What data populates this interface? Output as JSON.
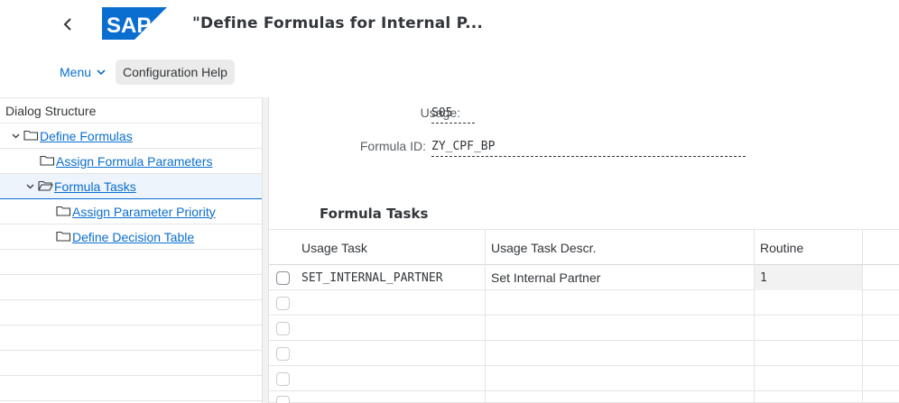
{
  "header": {
    "title": "\"Define Formulas for Internal P...",
    "logo_text": "SAP"
  },
  "toolbar": {
    "menu_label": "Menu",
    "config_help_label": "Configuration Help"
  },
  "dialog_structure": {
    "header": "Dialog Structure",
    "items": [
      {
        "label": "Define Formulas",
        "level": 1,
        "expanded": true,
        "selected": false
      },
      {
        "label": "Assign Formula Parameters",
        "level": 2,
        "expanded": false,
        "selected": false
      },
      {
        "label": "Formula Tasks",
        "level": 2,
        "expanded": true,
        "selected": true
      },
      {
        "label": "Assign Parameter Priority",
        "level": 3,
        "expanded": false,
        "selected": false
      },
      {
        "label": "Define Decision Table",
        "level": 3,
        "expanded": false,
        "selected": false
      }
    ]
  },
  "form": {
    "usage_label": "Usage:",
    "usage_value": "S05",
    "formula_id_label": "Formula ID:",
    "formula_id_value": "ZY_CPF_BP"
  },
  "section_title": "Formula Tasks",
  "table": {
    "columns": [
      "Usage Task",
      "Usage Task Descr.",
      "Routine"
    ],
    "rows": [
      [
        "SET_INTERNAL_PARTNER",
        "Set Internal Partner",
        "1"
      ],
      [
        "",
        "",
        ""
      ],
      [
        "",
        "",
        ""
      ],
      [
        "",
        "",
        ""
      ],
      [
        "",
        "",
        ""
      ],
      [
        "",
        "",
        ""
      ]
    ]
  },
  "colors": {
    "link": "#0a6ed1",
    "logo": "#0a6ed1",
    "text": "#32363a"
  }
}
